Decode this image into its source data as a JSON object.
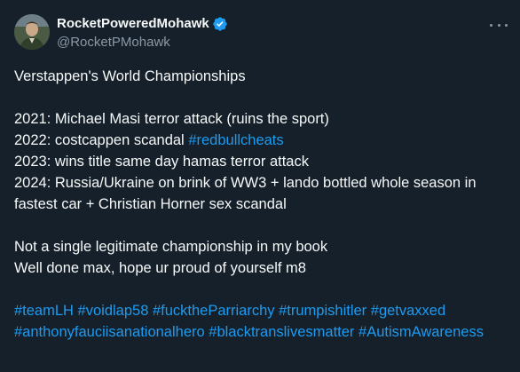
{
  "author": {
    "display_name": "RocketPoweredMohawk",
    "handle": "@RocketPMohawk",
    "verified": true,
    "avatar_icon": "avatar-photo"
  },
  "menu": {
    "icon": "more-horizontal-icon"
  },
  "tweet": {
    "title": "Verstappen's World Championships",
    "line_2021": "2021: Michael Masi terror attack (ruins the sport)",
    "line_2022_text": "2022: costcappen scandal ",
    "line_2022_tag": "#redbullcheats",
    "line_2023": "2023: wins title same day hamas terror attack",
    "line_2024": "2024: Russia/Ukraine on brink of WW3 + lando bottled whole season in fastest car + Christian Horner sex scandal",
    "closing_1": "Not a single legitimate championship in my book",
    "closing_2": "Well done max, hope ur proud of yourself m8",
    "hashtags": [
      "#teamLH",
      "#voidlap58",
      "#fucktheParriarchy",
      "#trumpishitler",
      "#getvaxxed",
      "#anthonyfauciisanationalhero",
      "#blacktranslivesmatter",
      "#AutismAwareness"
    ]
  },
  "colors": {
    "background": "#15202b",
    "text": "#f7f9f9",
    "secondary_text": "#8b98a5",
    "link": "#1d9bf0",
    "verified_badge": "#1d9bf0"
  }
}
